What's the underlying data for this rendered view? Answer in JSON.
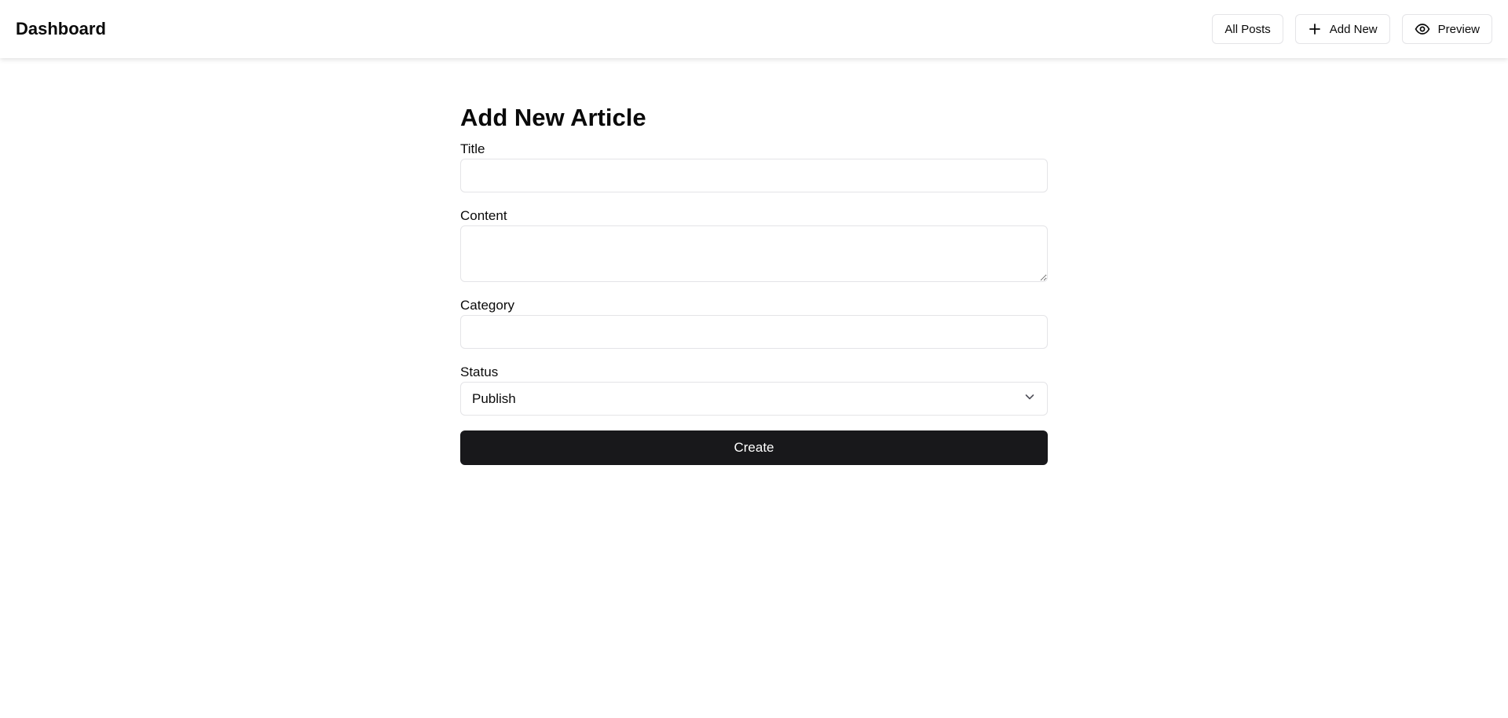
{
  "header": {
    "brand": "Dashboard",
    "nav": [
      {
        "label": "All Posts",
        "icon": null
      },
      {
        "label": "Add New",
        "icon": "plus-icon"
      },
      {
        "label": "Preview",
        "icon": "eye-icon"
      }
    ]
  },
  "form": {
    "heading": "Add New Article",
    "title_label": "Title",
    "title_value": "",
    "content_label": "Content",
    "content_value": "",
    "category_label": "Category",
    "category_value": "",
    "status_label": "Status",
    "status_value": "Publish",
    "submit_label": "Create"
  },
  "colors": {
    "primary_button": "#18181b",
    "border": "#e4e4e7",
    "text": "#0a0a0a"
  }
}
